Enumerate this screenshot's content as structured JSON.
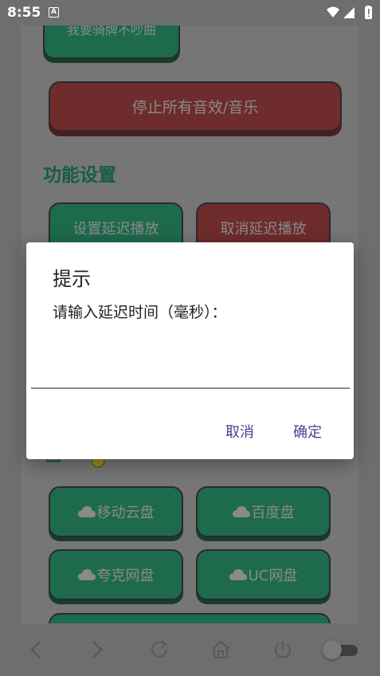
{
  "status_bar": {
    "time": "8:55",
    "notification_icon": "A"
  },
  "app": {
    "top_partial_button": "我要骑牌不吵曲",
    "stop_all_button": "停止所有音效/音乐",
    "section_title": "功能设置",
    "set_delay_button": "设置延迟播放",
    "cancel_delay_button": "取消延迟播放",
    "cloud_buttons": [
      {
        "label": "移动云盘",
        "icon": "cloud-icon"
      },
      {
        "label": "百度盘",
        "icon": "cloud-icon"
      },
      {
        "label": "夸克网盘",
        "icon": "cloud-icon"
      },
      {
        "label": "UC网盘",
        "icon": "cloud-icon"
      }
    ]
  },
  "dialog": {
    "title": "提示",
    "message": "请输入延迟时间（毫秒）：",
    "input_value": "",
    "cancel_label": "取消",
    "confirm_label": "确定"
  },
  "navbar": {
    "icons": [
      "back-icon",
      "forward-icon",
      "refresh-icon",
      "home-icon",
      "power-icon",
      "toggle-switch"
    ]
  },
  "colors": {
    "green_button": "#1e6a4d",
    "red_button": "#6e2c2c",
    "dialog_action": "#4b3d8f"
  }
}
